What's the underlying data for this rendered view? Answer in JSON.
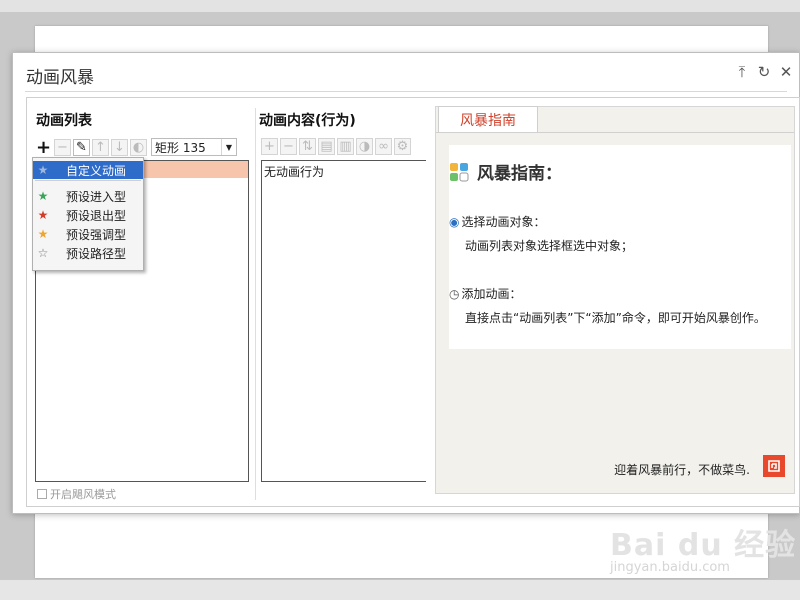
{
  "dialog": {
    "title": "动画风暴",
    "win_buttons": [
      "pin-icon",
      "refresh-icon",
      "close-icon"
    ]
  },
  "left": {
    "title": "动画列表",
    "combo_value": "矩形 135",
    "toolbar_icons": [
      "add-icon",
      "remove-icon",
      "brush-icon",
      "move-up-icon",
      "move-down-icon",
      "mirror-icon"
    ],
    "checkbox_label": "开启飓风模式"
  },
  "context_menu": {
    "items": [
      {
        "label": "自定义动画",
        "icon": "star-outline-icon",
        "active": true
      },
      {
        "label": "预设进入型",
        "icon": "star-green-icon"
      },
      {
        "label": "预设退出型",
        "icon": "star-red-icon"
      },
      {
        "label": "预设强调型",
        "icon": "star-orange-icon"
      },
      {
        "label": "预设路径型",
        "icon": "star-path-icon"
      }
    ]
  },
  "middle": {
    "title": "动画内容(行为)",
    "empty_text": "无动画行为"
  },
  "right": {
    "tab_label": "风暴指南",
    "guide_title": "风暴指南：",
    "step1_heading": "选择动画对象：",
    "step1_text": "动画列表对象选择框选中对象；",
    "step2_heading": "添加动画：",
    "step2_text": "直接点击“动画列表”下“添加”命令，即可开始风暴创作。",
    "footer": "迎着风暴前行，不做菜鸟."
  },
  "watermark": {
    "main": "Bai du 经验",
    "sub": "jingyan.baidu.com"
  },
  "colors": {
    "accent": "#d0432c",
    "menu_active": "#2f6bc9",
    "selection": "#f7c4ac"
  }
}
